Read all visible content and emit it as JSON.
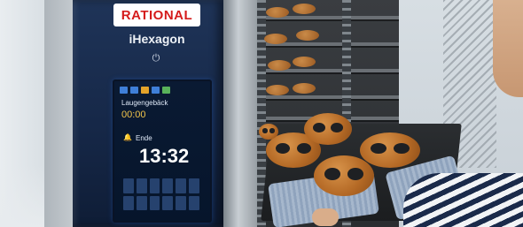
{
  "photo": {
    "subject": "oven with tray of pretzels"
  },
  "oven": {
    "brand": "RATIONAL",
    "model": "iHexagon",
    "power_symbol": "⏻",
    "screen": {
      "program": "Laugengebäck",
      "small_time": "00:00",
      "end_label": "Ende",
      "bell_symbol": "🔔",
      "big_time": "13:32"
    }
  },
  "colors": {
    "brand_red": "#d51c1c",
    "panel_blue": "#1f3458"
  }
}
